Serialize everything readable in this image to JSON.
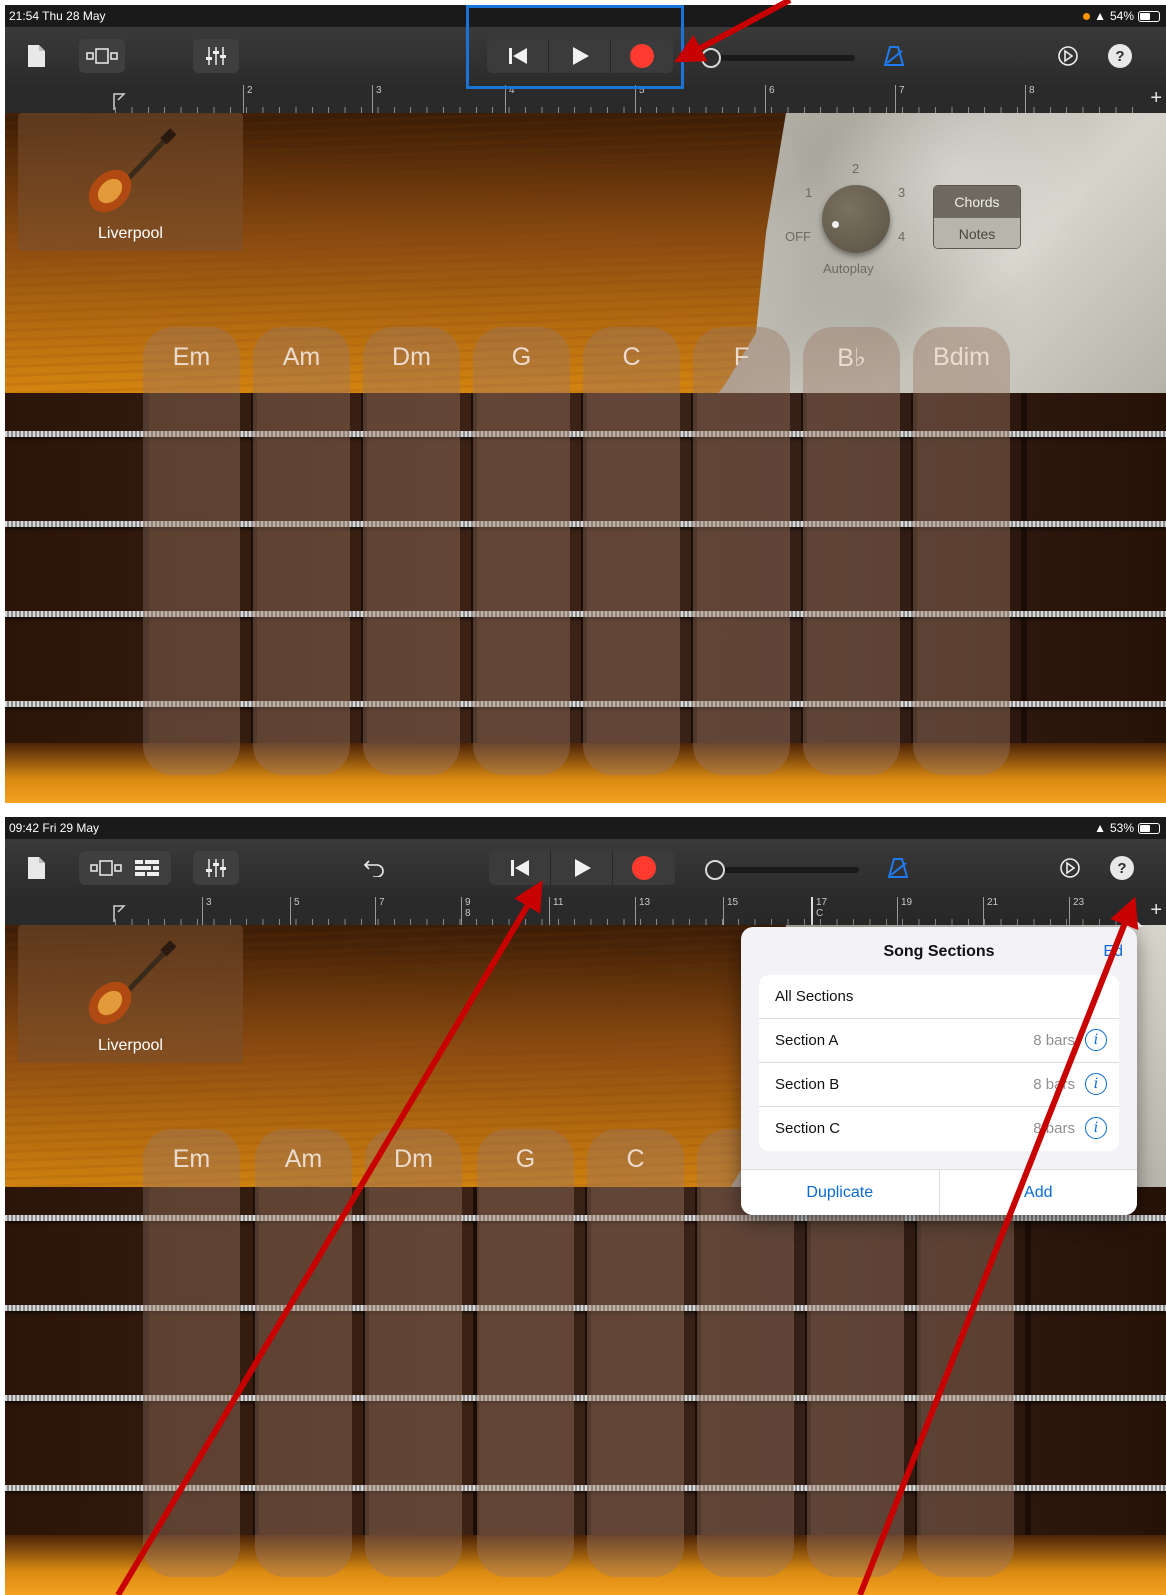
{
  "accent": {
    "blue": "#1a74d8",
    "record": "#ff3b30",
    "annotation": "#c80000"
  },
  "screens": [
    {
      "status": {
        "time": "21:54  Thu 28 May",
        "battery": "54%"
      },
      "ruler": [
        "2",
        "3",
        "4",
        "5",
        "6",
        "7",
        "8"
      ],
      "instrument": "Liverpool",
      "chords": [
        "Em",
        "Am",
        "Dm",
        "G",
        "C",
        "F",
        "B♭",
        "Bdim"
      ],
      "autoplay": {
        "title": "Autoplay",
        "off": "OFF",
        "n1": "1",
        "n2": "2",
        "n3": "3",
        "n4": "4"
      },
      "mode": {
        "chords": "Chords",
        "notes": "Notes",
        "selected": "Chords"
      }
    },
    {
      "status": {
        "time": "09:42  Fri 29 May",
        "battery": "53%"
      },
      "ruler": [
        "3",
        "5",
        "7",
        "9",
        "11",
        "13",
        "15",
        "17",
        "19",
        "21",
        "23"
      ],
      "ruler_sub": {
        "9": "8",
        "17": "C"
      },
      "instrument": "Liverpool",
      "chords": [
        "Em",
        "Am",
        "Dm",
        "G",
        "C"
      ],
      "popover": {
        "title": "Song Sections",
        "edit": "Ed",
        "rows": [
          {
            "name": "All Sections",
            "bars": ""
          },
          {
            "name": "Section A",
            "bars": "8 bars"
          },
          {
            "name": "Section B",
            "bars": "8 bars"
          },
          {
            "name": "Section C",
            "bars": "8 bars"
          }
        ],
        "duplicate": "Duplicate",
        "add": "Add"
      }
    }
  ],
  "icons": [
    "document-icon",
    "track-view-icon",
    "mixer-icon",
    "tracks-list-icon",
    "undo-icon",
    "go-to-start-icon",
    "play-icon",
    "record-icon",
    "metronome-icon",
    "settings-icon",
    "help-icon",
    "info-icon"
  ],
  "help_label": "?"
}
